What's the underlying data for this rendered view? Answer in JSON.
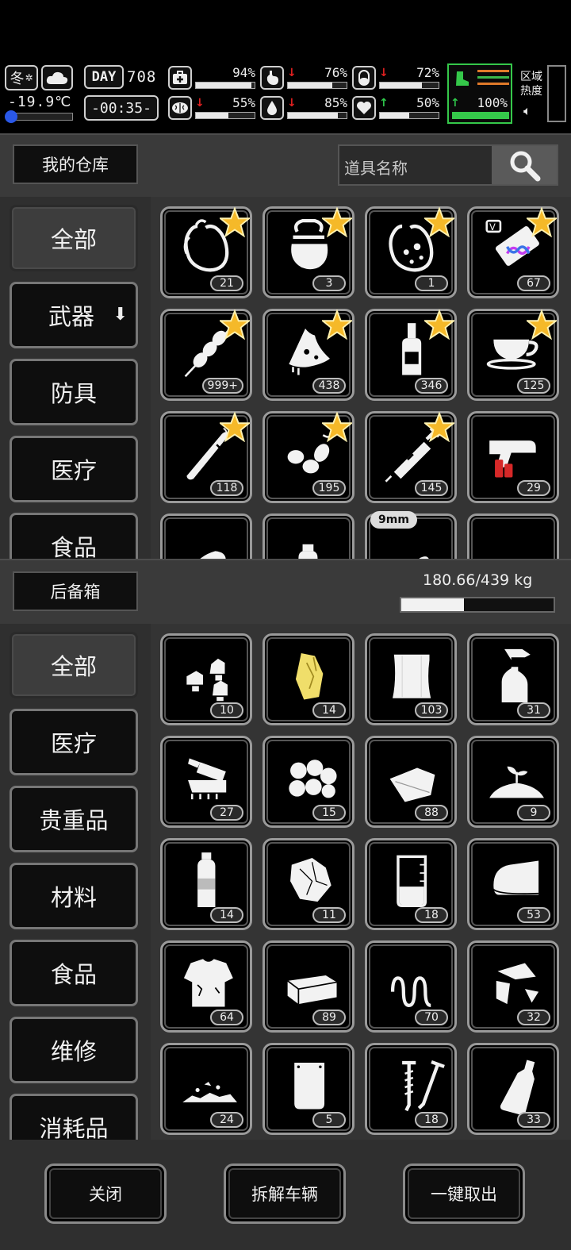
{
  "hud": {
    "season": "冬",
    "temperature": "-19.9℃",
    "day_label": "DAY",
    "day_number": "708",
    "clock": "-00:35-",
    "zone_heat_line1": "区域",
    "zone_heat_line2": "热度",
    "stats": [
      {
        "id": "health",
        "icon": "medkit-icon",
        "value": "94%",
        "trend": "",
        "fill": 0.94
      },
      {
        "id": "hunger",
        "icon": "stomach-icon",
        "value": "76%",
        "trend": "down",
        "fill": 0.76
      },
      {
        "id": "energy",
        "icon": "pill-icon",
        "value": "72%",
        "trend": "down",
        "fill": 0.72
      },
      {
        "id": "sanity",
        "icon": "brain-icon",
        "value": "55%",
        "trend": "down",
        "fill": 0.55
      },
      {
        "id": "thirst",
        "icon": "water-drop-icon",
        "value": "85%",
        "trend": "down",
        "fill": 0.85
      },
      {
        "id": "mood",
        "icon": "heart-icon",
        "value": "50%",
        "trend": "up",
        "fill": 0.5
      },
      {
        "id": "stamina",
        "icon": "boot-icon",
        "value": "100%",
        "trend": "up",
        "fill": 1.0
      }
    ],
    "colors": {
      "down": "#e02020",
      "up": "#2fc84a",
      "stamina_bar": "#35c84a",
      "heat_orange": "#e07a2a",
      "heat_green": "#3ab84a"
    }
  },
  "warehouse": {
    "title": "我的仓库",
    "search_placeholder": "道具名称",
    "categories": [
      {
        "label": "全部",
        "active": true
      },
      {
        "label": "武器",
        "active": false,
        "has_arrow": true
      },
      {
        "label": "防具",
        "active": false
      },
      {
        "label": "医疗",
        "active": false
      },
      {
        "label": "食品",
        "active": false
      }
    ],
    "items": [
      {
        "icon": "empty-pouch-icon",
        "count": "21",
        "starred": true
      },
      {
        "icon": "water-pouch-icon",
        "count": "3",
        "starred": true
      },
      {
        "icon": "dirty-pouch-icon",
        "count": "1",
        "starred": true
      },
      {
        "icon": "dna-candy-icon",
        "count": "67",
        "starred": true,
        "badge": "V"
      },
      {
        "icon": "meat-skewer-icon",
        "count": "999+",
        "starred": true
      },
      {
        "icon": "cheese-icon",
        "count": "438",
        "starred": true
      },
      {
        "icon": "liquor-bottle-icon",
        "count": "346",
        "starred": true
      },
      {
        "icon": "coffee-cup-icon",
        "count": "125",
        "starred": true
      },
      {
        "icon": "cigar-icon",
        "count": "118",
        "starred": true
      },
      {
        "icon": "nuts-icon",
        "count": "195",
        "starred": true
      },
      {
        "icon": "syringe-icon",
        "count": "145",
        "starred": true
      },
      {
        "icon": "flare-gun-icon",
        "count": "29",
        "starred": false
      },
      {
        "icon": "bread-icon",
        "count": "",
        "starred": false
      },
      {
        "icon": "water-bottle-icon",
        "count": "",
        "starred": false
      },
      {
        "icon": "bullet-icon",
        "count": "",
        "starred": false,
        "tag": "9mm"
      },
      {
        "icon": "bandage-roll-icon",
        "count": "",
        "starred": false
      }
    ]
  },
  "trunk": {
    "title": "后备箱",
    "weight_text": "180.66/439 kg",
    "weight_fraction": 0.4115,
    "categories": [
      {
        "label": "全部",
        "active": true
      },
      {
        "label": "医疗",
        "active": false
      },
      {
        "label": "贵重品",
        "active": false
      },
      {
        "label": "材料",
        "active": false
      },
      {
        "label": "食品",
        "active": false
      },
      {
        "label": "维修",
        "active": false
      },
      {
        "label": "消耗品",
        "active": false
      }
    ],
    "items": [
      {
        "icon": "spark-plugs-icon",
        "count": "10"
      },
      {
        "icon": "gold-ore-icon",
        "count": "14"
      },
      {
        "icon": "cloth-icon",
        "count": "103"
      },
      {
        "icon": "spray-bottle-icon",
        "count": "31"
      },
      {
        "icon": "electronics-scrap-icon",
        "count": "27"
      },
      {
        "icon": "cotton-balls-icon",
        "count": "15"
      },
      {
        "icon": "fabric-sheet-icon",
        "count": "88"
      },
      {
        "icon": "soil-sprout-icon",
        "count": "9"
      },
      {
        "icon": "plastic-bottle-icon",
        "count": "14"
      },
      {
        "icon": "crumpled-paper-icon",
        "count": "11"
      },
      {
        "icon": "beaker-icon",
        "count": "18"
      },
      {
        "icon": "folded-towel-icon",
        "count": "53"
      },
      {
        "icon": "torn-shirt-icon",
        "count": "64"
      },
      {
        "icon": "box-icon",
        "count": "89"
      },
      {
        "icon": "spring-icon",
        "count": "70"
      },
      {
        "icon": "glass-shards-icon",
        "count": "32"
      },
      {
        "icon": "rubble-icon",
        "count": "24"
      },
      {
        "icon": "pouch-bag-icon",
        "count": "5"
      },
      {
        "icon": "screws-icon",
        "count": "18"
      },
      {
        "icon": "glass-bottle-icon",
        "count": "33"
      }
    ]
  },
  "footer": {
    "close_label": "关闭",
    "dismantle_label": "拆解车辆",
    "take_all_label": "一键取出"
  }
}
